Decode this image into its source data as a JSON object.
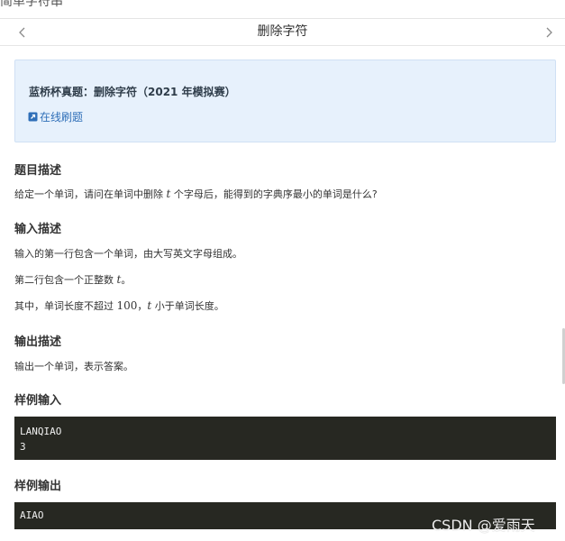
{
  "page_cut_title": "简单字符串",
  "nav": {
    "title": "删除字符"
  },
  "info": {
    "title": "蓝桥杯真题：删除字符（2021 年模拟赛）",
    "link_label": "在线刷题"
  },
  "description": {
    "heading": "题目描述",
    "text_before": "给定一个单词，请问在单词中删除 ",
    "var_t": "t",
    "text_after": " 个字母后，能得到的字典序最小的单词是什么?"
  },
  "input_desc": {
    "heading": "输入描述",
    "line1": "输入的第一行包含一个单词，由大写英文字母组成。",
    "line2_before": "第二行包含一个正整数 ",
    "line2_var": "t",
    "line2_after": "。",
    "line3_before": "其中，单词长度不超过 ",
    "line3_num": "100",
    "line3_sep": "，",
    "line3_var": "t",
    "line3_after": " 小于单词长度。"
  },
  "output_desc": {
    "heading": "输出描述",
    "line1": "输出一个单词，表示答案。"
  },
  "sample_input": {
    "heading": "样例输入",
    "lines": [
      "LANQIAO",
      "3"
    ]
  },
  "sample_output": {
    "heading": "样例输出",
    "lines": [
      "AIAO"
    ]
  },
  "watermark": "CSDN @爱雨天",
  "colors": {
    "info_bg": "#e7f1fc",
    "link": "#2f6fb8",
    "code_bg": "#272822"
  }
}
